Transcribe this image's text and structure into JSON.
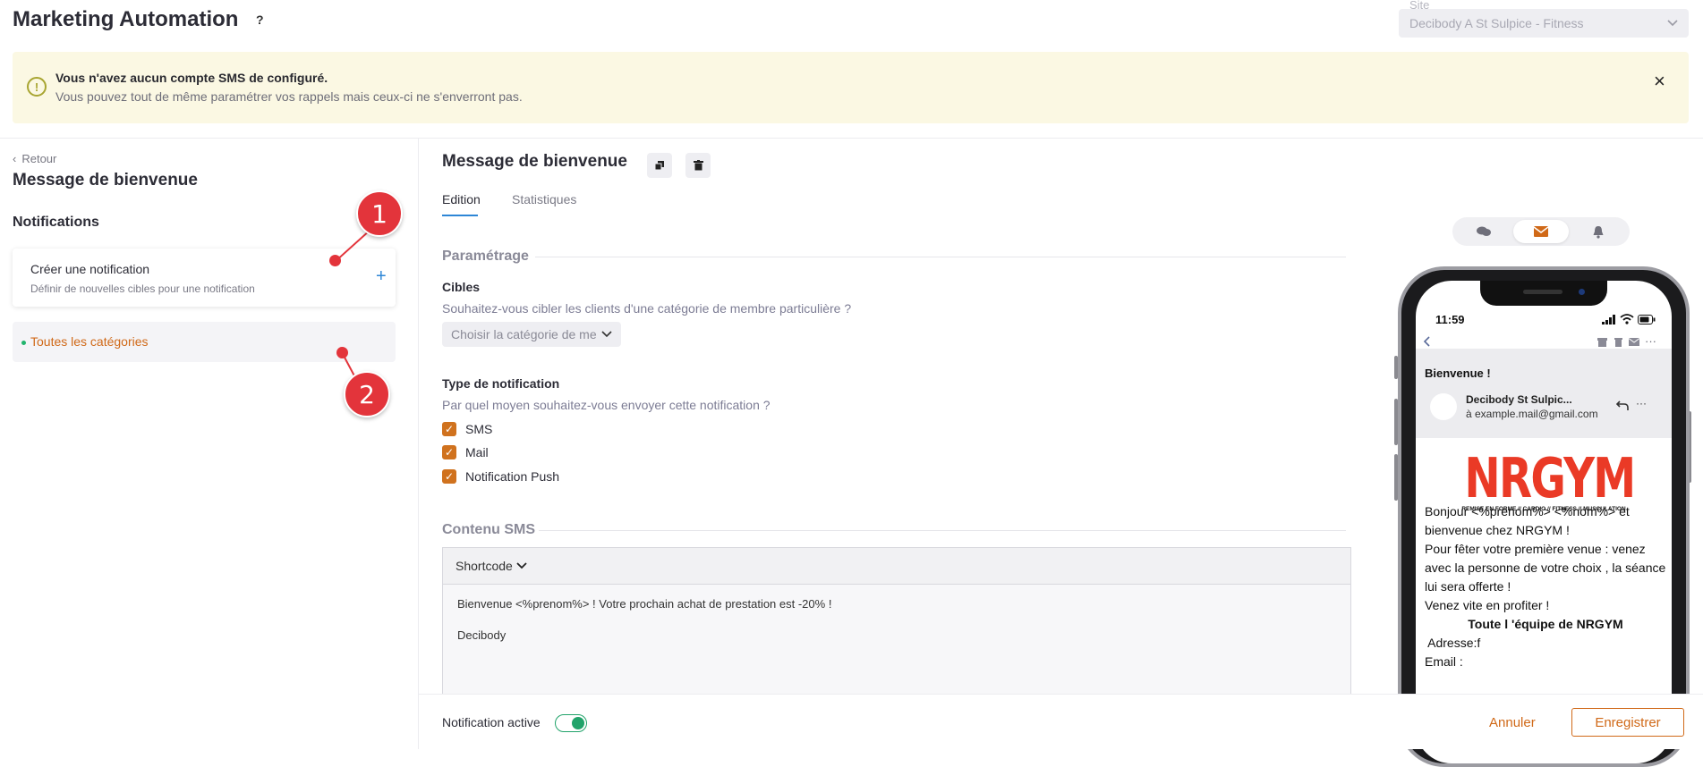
{
  "header": {
    "title": "Marketing Automation",
    "help": "?",
    "site_label": "Site",
    "site_value": "Decibody A St Sulpice - Fitness"
  },
  "alert": {
    "icon": "!",
    "title": "Vous n'avez aucun compte SMS de configuré.",
    "description": "Vous pouvez tout de même paramétrer vos rappels mais ceux-ci ne s'enverront pas.",
    "close": "×"
  },
  "left": {
    "back": "Retour",
    "title": "Message de bienvenue",
    "section": "Notifications",
    "create_card": {
      "title": "Créer une notification",
      "subtitle": "Définir de nouvelles cibles pour une notification",
      "plus": "+"
    },
    "category_item": "Toutes les catégories"
  },
  "markers": [
    {
      "number": "1"
    },
    {
      "number": "2"
    }
  ],
  "main": {
    "title": "Message de bienvenue",
    "tabs": [
      {
        "label": "Edition"
      },
      {
        "label": "Statistiques"
      }
    ],
    "parametrage_heading": "Paramétrage",
    "cibles_label": "Cibles",
    "cibles_help": "Souhaitez-vous cibler les clients d'une catégorie de membre particulière ?",
    "cibles_select": "Choisir la catégorie de me",
    "type_label": "Type de notification",
    "type_help": "Par quel moyen souhaitez-vous envoyer cette notification ?",
    "checkboxes": [
      {
        "label": "SMS",
        "checked": true
      },
      {
        "label": "Mail",
        "checked": true
      },
      {
        "label": "Notification Push",
        "checked": true
      }
    ],
    "sms_heading": "Contenu SMS",
    "shortcode": "Shortcode",
    "sms_line1": "Bienvenue <%prenom%> ! Votre prochain achat de prestation est  -20% !",
    "sms_line2": "Decibody"
  },
  "footer": {
    "active_label": "Notification active",
    "active_on": true,
    "cancel": "Annuler",
    "save": "Enregistrer"
  },
  "preview": {
    "clock": "11:59",
    "subject": "Bienvenue !",
    "sender": "Decibody St Sulpic...",
    "to": "à example.mail@gmail.com",
    "logo_main": "NRGYM",
    "logo_tagline": "REMISE EN FORME // CARDIO // FITNESS // MUSCULATION",
    "body": [
      "Bonjour <%prenom%> <%nom%> et bienvenue chez NRGYM !",
      "Pour fêter votre première venue  : venez avec la personne de votre choix , la séance lui sera offerte !",
      "Venez vite en profiter !",
      "Toute l 'équipe de NRGYM",
      " Adresse:f",
      "Email :"
    ]
  },
  "colors": {
    "accent_orange": "#d06918",
    "link_blue": "#2d86d6",
    "marker_red": "#e3343b",
    "toggle_green": "#21a36a"
  }
}
